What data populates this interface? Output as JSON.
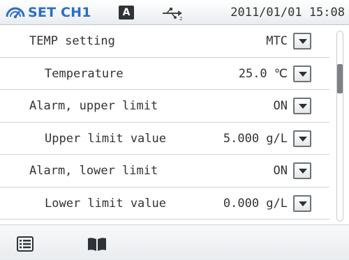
{
  "status_bar": {
    "title": "SET CH1",
    "mode_badge": "A",
    "datetime": "2011/01/01 15:08",
    "icons": [
      "settings-icon",
      "usb-icon"
    ]
  },
  "settings": [
    {
      "label": "TEMP setting",
      "value": "MTC"
    },
    {
      "label": "Temperature",
      "value": "25.0 ℃"
    },
    {
      "label": "Alarm, upper limit",
      "value": "ON"
    },
    {
      "label": "Upper limit value",
      "value": "5.000 g/L"
    },
    {
      "label": "Alarm, lower limit",
      "value": "ON"
    },
    {
      "label": "Lower limit value",
      "value": "0.000 g/L"
    }
  ],
  "bottom_bar": {
    "icons": [
      "list-icon",
      "book-icon"
    ]
  },
  "colors": {
    "accent": "#2b6fc6",
    "text": "#333333",
    "divider": "#d0d4d8",
    "badge": "#2f3338",
    "scroll_thumb": "#7c8184"
  }
}
